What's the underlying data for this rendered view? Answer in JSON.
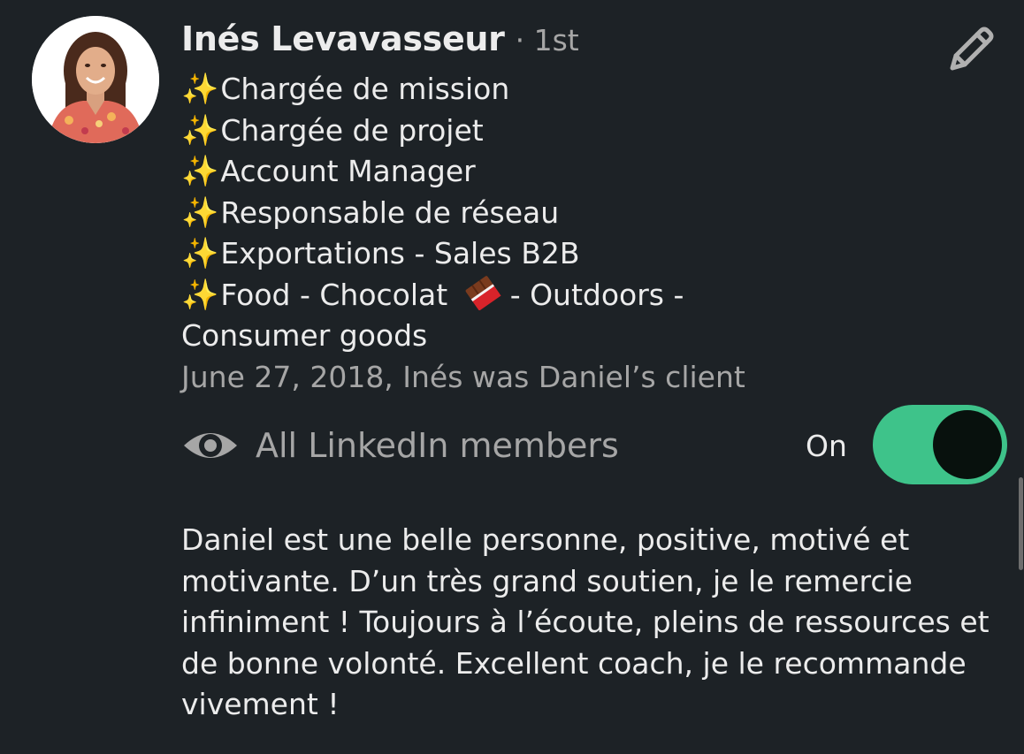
{
  "recommender": {
    "name": "Inés Levavasseur",
    "degree": "· 1st",
    "headline_lines": [
      {
        "icon": "sparkles-icon",
        "text": "Chargée de mission"
      },
      {
        "icon": "sparkles-icon",
        "text": "Chargée de projet"
      },
      {
        "icon": "sparkles-icon",
        "text": "Account Manager"
      },
      {
        "icon": "sparkles-icon",
        "text": "Responsable de réseau"
      },
      {
        "icon": "sparkles-icon",
        "text": "Exportations - Sales B2B"
      },
      {
        "icon": "sparkles-icon",
        "text_before": "Food - Chocolat",
        "emoji_icon": "chocolate-bar-icon",
        "text_after": "- Outdoors -"
      }
    ],
    "headline_tail": "Consumer goods",
    "relationship": "June 27, 2018, Inés was Daniel’s client"
  },
  "visibility": {
    "icon": "eye-icon",
    "label": "All LinkedIn members",
    "toggle_state_label": "On",
    "toggle_on": true
  },
  "recommendation_text": "Daniel est une belle personne, positive, motivé et motivante. D’un très grand soutien, je le remercie infiniment ! Toujours à l’écoute, pleins de ressources et de bonne volonté. Excellent coach, je le recommande vivement !",
  "colors": {
    "background": "#1d2226",
    "toggle_on": "#3ec38a",
    "muted_text": "#a6a6a6",
    "primary_text": "#ececec"
  }
}
